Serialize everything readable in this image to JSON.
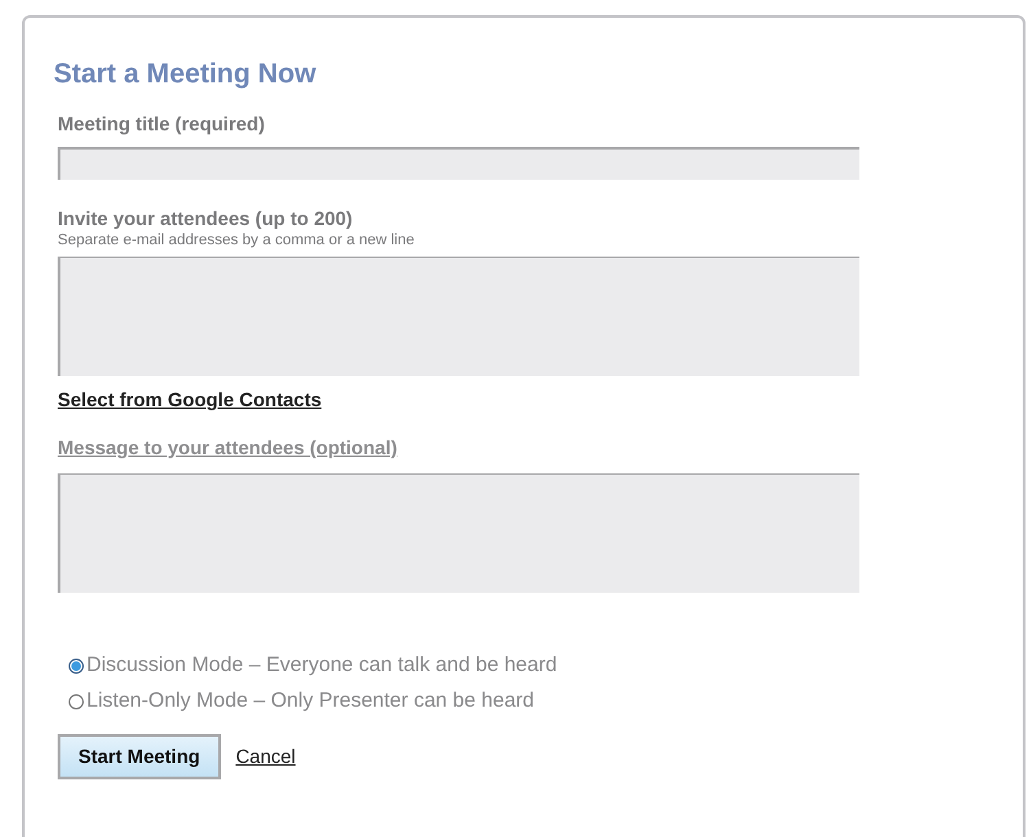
{
  "title": "Start a Meeting Now",
  "meeting_title": {
    "label": "Meeting title (required)"
  },
  "invite": {
    "label": "Invite your attendees (up to 200)",
    "hint": "Separate e-mail addresses by a comma or a new line"
  },
  "contacts_link": "Select from Google Contacts",
  "message": {
    "label": "Message to your attendees (optional)"
  },
  "modes": [
    {
      "label": "Discussion Mode – Everyone can talk and be heard",
      "selected": true
    },
    {
      "label": "Listen-Only Mode – Only Presenter can be heard",
      "selected": false
    }
  ],
  "buttons": {
    "primary": "Start Meeting",
    "cancel": "Cancel"
  }
}
